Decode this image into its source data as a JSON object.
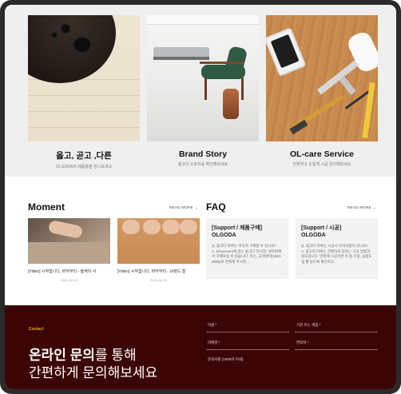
{
  "features": [
    {
      "title": "옳고, 곧고 ,다른",
      "subtitle": "OLGODA의 제품들을 만나보세요"
    },
    {
      "title": "Brand Story",
      "subtitle": "올고다 스토리를 확인해보세요"
    },
    {
      "title": "OL-care Service",
      "subtitle": "간편하고 손쉽게 시공 문의해보세요"
    }
  ],
  "moment": {
    "title": "Moment",
    "read_more": "READ MORE  →",
    "items": [
      {
        "caption": "[Video] 시작합니다, 바닥부터 - 올케어 서",
        "date": "2021-04-15"
      },
      {
        "caption": "[Video] 시작합니다, 바닥부터 - 브랜드 철",
        "date": "2021-04-15"
      }
    ]
  },
  "faq": {
    "title": "FAQ",
    "read_more": "READ MORE  →",
    "items": [
      {
        "question": "[Support / 제품구매]\nOLGODA",
        "answer": "Q. 올고다 마루는 어디서 구매할 수 있나요?\nA. Showroom에 있는 올고다 전시장, 네이버에서 구매하실 수 있습니다. 또는, 고객센터(1661-8999)로 연락해 주시면..."
      },
      {
        "question": "[Support / 시공]\nOLGODA",
        "answer": "Q. 올고다 마루는 시공시 유의사항이 있나요?\nA. 올고다 마루는 간편하게 접하는 시공 방법과 용도입니다. 먼저에 시공하면 미 등 우중, 습함도 및 웰 맞도록 확인하고..."
      }
    ]
  },
  "contact": {
    "label": "Contact",
    "headline_bold": "온라인 문의",
    "headline_rest": "를 통해",
    "headline_line2": "간편하게 문의해보세요",
    "fields": {
      "name": "이름 *",
      "company": "기관 또는 개업 *",
      "email": "이메일 *",
      "phone": "연락처 *",
      "message": "문의사항 (1000자 이내)"
    }
  }
}
